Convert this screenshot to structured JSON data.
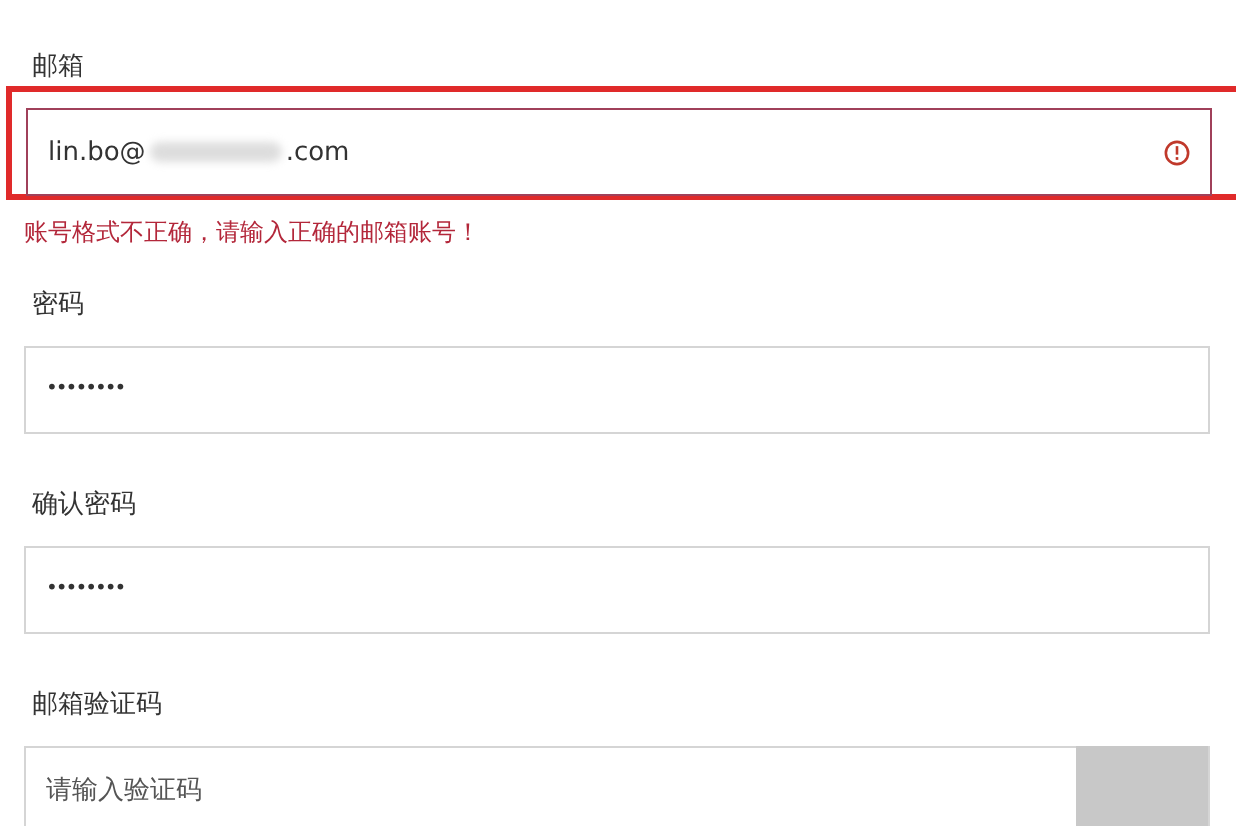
{
  "fields": [
    {
      "kind": "email",
      "label": "邮箱",
      "value_start": "lin.bo@",
      "value_end": ".com",
      "redacted": true,
      "invalid": true,
      "highlighted": true,
      "error": "账号格式不正确，请输入正确的邮箱账号！"
    },
    {
      "kind": "password",
      "label": "密码",
      "value": "••••••••",
      "invalid": false,
      "highlighted": false
    },
    {
      "kind": "password",
      "label": "确认密码",
      "value": "••••••••",
      "invalid": false,
      "highlighted": false
    },
    {
      "kind": "code",
      "label": "邮箱验证码",
      "placeholder": "请输入验证码",
      "invalid": false,
      "highlighted": false
    }
  ]
}
